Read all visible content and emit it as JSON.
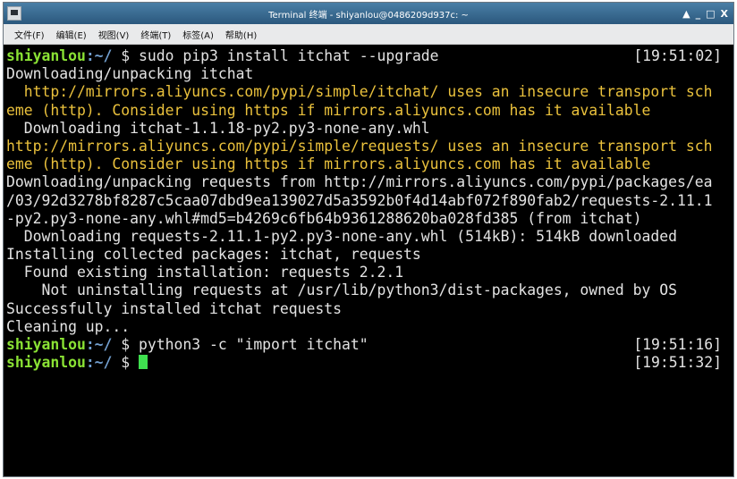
{
  "window": {
    "title": "Terminal 终端 - shiyanlou@0486209d937c: ~",
    "controls": {
      "minimize": "▲",
      "restore": "_",
      "maximize": "□",
      "close": "X"
    }
  },
  "menu": [
    {
      "label": "文件(F)"
    },
    {
      "label": "编辑(E)"
    },
    {
      "label": "视图(V)"
    },
    {
      "label": "终端(T)"
    },
    {
      "label": "标签(A)"
    },
    {
      "label": "帮助(H)"
    }
  ],
  "terminal": {
    "lines": [
      {
        "type": "prompt",
        "user": "shiyanlou",
        "path": ":~/",
        "sym": " $ ",
        "cmd": "sudo pip3 install itchat --upgrade",
        "time": "[19:51:02]"
      },
      {
        "type": "text",
        "text": "Downloading/unpacking itchat"
      },
      {
        "type": "warn",
        "text": "  http://mirrors.aliyuncs.com/pypi/simple/itchat/ uses an insecure transport sch"
      },
      {
        "type": "warn",
        "text": "eme (http). Consider using https if mirrors.aliyuncs.com has it available"
      },
      {
        "type": "text",
        "text": "  Downloading itchat-1.1.18-py2.py3-none-any.whl"
      },
      {
        "type": "warn",
        "text": "http://mirrors.aliyuncs.com/pypi/simple/requests/ uses an insecure transport sch"
      },
      {
        "type": "warn",
        "text": "eme (http). Consider using https if mirrors.aliyuncs.com has it available"
      },
      {
        "type": "text",
        "text": "Downloading/unpacking requests from http://mirrors.aliyuncs.com/pypi/packages/ea"
      },
      {
        "type": "text",
        "text": "/03/92d3278bf8287c5caa07dbd9ea139027d5a3592b0f4d14abf072f890fab2/requests-2.11.1"
      },
      {
        "type": "text",
        "text": "-py2.py3-none-any.whl#md5=b4269c6fb64b9361288620ba028fd385 (from itchat)"
      },
      {
        "type": "text",
        "text": "  Downloading requests-2.11.1-py2.py3-none-any.whl (514kB): 514kB downloaded"
      },
      {
        "type": "text",
        "text": "Installing collected packages: itchat, requests"
      },
      {
        "type": "text",
        "text": "  Found existing installation: requests 2.2.1"
      },
      {
        "type": "text",
        "text": "    Not uninstalling requests at /usr/lib/python3/dist-packages, owned by OS"
      },
      {
        "type": "text",
        "text": "Successfully installed itchat requests"
      },
      {
        "type": "text",
        "text": "Cleaning up..."
      },
      {
        "type": "prompt",
        "user": "shiyanlou",
        "path": ":~/",
        "sym": " $ ",
        "cmd": "python3 -c \"import itchat\"",
        "time": "[19:51:16]"
      },
      {
        "type": "prompt",
        "user": "shiyanlou",
        "path": ":~/",
        "sym": " $ ",
        "cmd": "",
        "time": "[19:51:32]",
        "cursor": true
      }
    ]
  },
  "colors": {
    "background": "#000000",
    "foreground": "#e3e3e3",
    "user": "#8ae234",
    "path": "#729fcf",
    "warning": "#eac13c",
    "cursor": "#3fe04f",
    "titlebar": "#2b587d"
  }
}
